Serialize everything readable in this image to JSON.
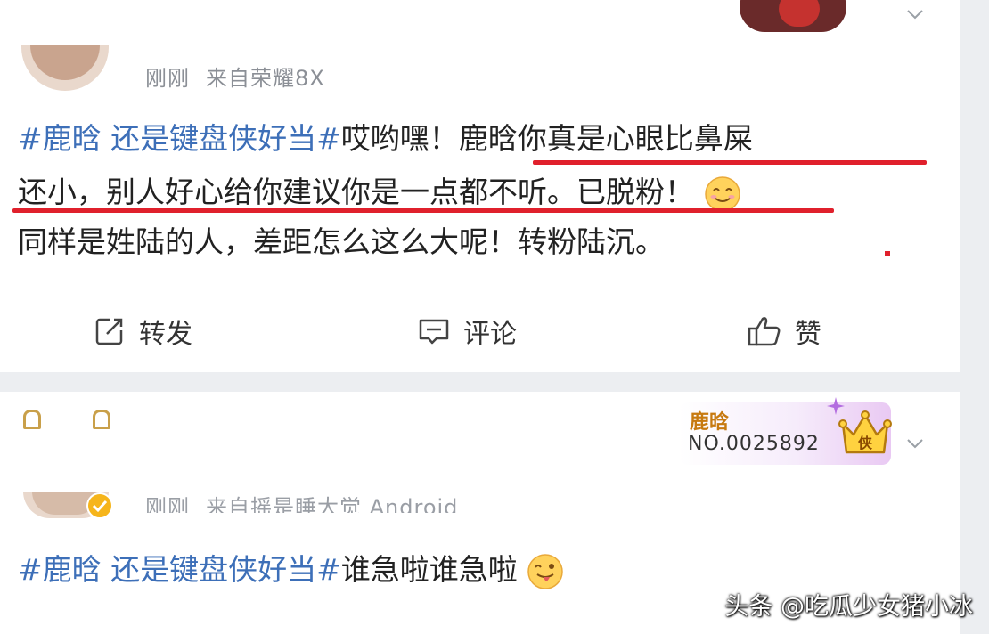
{
  "post1": {
    "meta_time": "刚刚",
    "meta_source": "来自荣耀8X",
    "tag": "#鹿晗 还是键盘侠好当#",
    "text_a": "哎哟嘿！",
    "highlight_1": "鹿晗你真是心眼比鼻屎",
    "line2_highlight": "还小，别人好心给你建议你是一点都不听。",
    "line2_tail": "已脱粉！",
    "line3": "同样是姓陆的人，差距怎么这么大呢！转粉陆沉。",
    "actions": {
      "repost": "转发",
      "comment": "评论",
      "like": "赞"
    }
  },
  "post2": {
    "meta_time": "刚刚",
    "meta_source": "来自摇是睡大觉 Android",
    "badge_name": "鹿晗",
    "badge_no": "NO.0025892",
    "badge_crown_text": "侠",
    "tag": "#鹿晗 还是键盘侠好当#",
    "text": "谁急啦谁急啦"
  },
  "watermark": "头条 @吃瓜少女猪小冰",
  "colors": {
    "tag_blue": "#3d6fb8",
    "underline_red": "#e0202c",
    "meta_gray": "#8b8f96"
  }
}
